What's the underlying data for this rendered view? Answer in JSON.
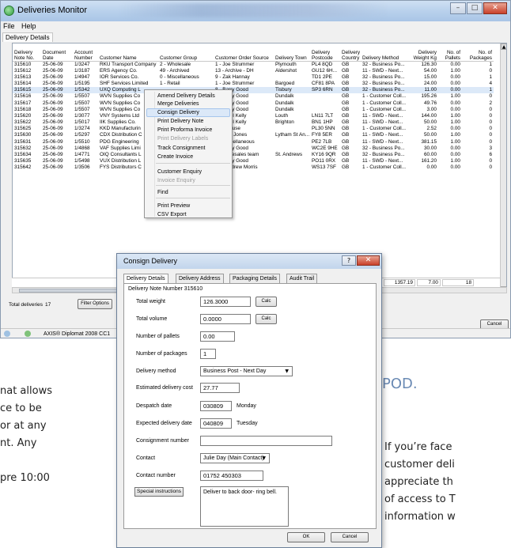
{
  "window": {
    "title": "Deliveries Monitor",
    "menu": [
      "File",
      "Help"
    ],
    "tab": "Delivery Details",
    "controls": [
      "–",
      "□",
      "✕"
    ]
  },
  "grid": {
    "columns": [
      "Delivery Note No.",
      "Document Date",
      "Account Number",
      "Customer Name",
      "Customer Group",
      "Customer Order Source",
      "Delivery Town",
      "Delivery Postcode",
      "Delivery Country",
      "Delivery Method",
      "Delivery Weight Kg",
      "No. of Pallets",
      "No. of Packages"
    ],
    "rows": [
      [
        "315610",
        "25-06-09",
        "1/3247",
        "RKU Transport Company",
        "2 - Wholesale",
        "1 - Joe Strummer",
        "Plymouth",
        "PL4 8QD",
        "GB",
        "32 - Business Po...",
        "126.30",
        "0.00",
        "1"
      ],
      [
        "315612",
        "25-06-09",
        "1/3187",
        "ERS Agency Co.",
        "49 - Archived",
        "13 - Archive - DH",
        "Aldershot",
        "GU12 6H...",
        "GB",
        "11 - SWD - Next...",
        "54.00",
        "1.00",
        "0"
      ],
      [
        "315613",
        "25-06-09",
        "1/4947",
        "IOR Services Co.",
        "0 - Miscellaneous",
        "9 - Zak Hannay",
        "",
        "TD1 2PE",
        "GB",
        "32 - Business Po...",
        "15.00",
        "0.00",
        "1"
      ],
      [
        "315614",
        "25-06-09",
        "1/5195",
        "SHF Services Limited",
        "1 - Retail",
        "1 - Joe Strummer",
        "Bargoed",
        "CF81 8PA",
        "GB",
        "32 - Business Po...",
        "24.00",
        "0.00",
        "4"
      ],
      [
        "315615",
        "25-06-09",
        "1/5342",
        "UXQ Computing L",
        "",
        "8 - Barry Good",
        "Tisbury",
        "SP3 6RN",
        "GB",
        "32 - Business Po...",
        "11.00",
        "0.00",
        "1"
      ],
      [
        "315616",
        "25-06-09",
        "1/5507",
        "WVN Supplies Co",
        "",
        "8 - Barry Good",
        "Dundalk",
        "",
        "GB",
        "1 - Customer Coll...",
        "195.26",
        "1.00",
        "0"
      ],
      [
        "315617",
        "25-06-09",
        "1/5507",
        "WVN Supplies Co",
        "",
        "8 - Barry Good",
        "Dundalk",
        "",
        "GB",
        "1 - Customer Coll...",
        "49.76",
        "0.00",
        "2"
      ],
      [
        "315618",
        "25-06-09",
        "1/5507",
        "WVN Supplies Co",
        "",
        "8 - Barry Good",
        "Dundalk",
        "",
        "GB",
        "1 - Customer Coll...",
        "3.00",
        "0.00",
        "0"
      ],
      [
        "315620",
        "25-06-09",
        "1/3077",
        "VNY Systems Ltd",
        "",
        "3 - Nigel Kelly",
        "Louth",
        "LN11 7LT",
        "GB",
        "11 - SWD - Next...",
        "144.00",
        "1.00",
        "0"
      ],
      [
        "315622",
        "25-06-09",
        "1/5017",
        "IIK Supplies Co.",
        "",
        "3 - Nigel Kelly",
        "Brighton",
        "BN1 1HP",
        "GB",
        "11 - SWD - Next...",
        "50.00",
        "1.00",
        "0"
      ],
      [
        "315625",
        "25-06-09",
        "1/3274",
        "KKD Manufacturin",
        "",
        "6 - Inhouse",
        "",
        "PL30 5NN",
        "GB",
        "1 - Customer Coll...",
        "2.52",
        "0.00",
        "0"
      ],
      [
        "315630",
        "25-06-09",
        "1/5297",
        "CDX Distribution C",
        "",
        "2 - Ellie Jones",
        "Lytham St An...",
        "FY8 5ER",
        "GB",
        "11 - SWD - Next...",
        "50.00",
        "1.00",
        "0"
      ],
      [
        "315631",
        "25-06-09",
        "1/5510",
        "PDG Engineering",
        "",
        "0 - Miscellaneous",
        "",
        "PE2 7LB",
        "GB",
        "11 - SWD - Next...",
        "381.15",
        "1.00",
        "0"
      ],
      [
        "315632",
        "25-06-09",
        "1/4868",
        "VAF Supplies Limi",
        "",
        "8 - Barry Good",
        "",
        "WC2E 9HE",
        "GB",
        "32 - Business Po...",
        "30.00",
        "0.00",
        "3"
      ],
      [
        "315634",
        "25-06-09",
        "1/4771",
        "OIQ Consultants L",
        "",
        "10 - Telesales team",
        "St. Andrews",
        "KY16 9QR",
        "GB",
        "32 - Business Po...",
        "60.00",
        "0.00",
        "6"
      ],
      [
        "315635",
        "25-06-09",
        "1/5498",
        "VUX Distribution L",
        "",
        "8 - Barry Good",
        "",
        "PO11 0RX",
        "GB",
        "11 - SWD - Next...",
        "161.20",
        "1.00",
        "0"
      ],
      [
        "315642",
        "25-06-09",
        "1/3506",
        "FYS Distributors C",
        "",
        "20 - Andrew Morris",
        "",
        "WS13 7SF",
        "GB",
        "1 - Customer Coll...",
        "0.00",
        "0.00",
        "0"
      ]
    ],
    "selected_row": 4,
    "totals": {
      "weight": "1357.19",
      "pallets": "7.00",
      "packages": "18"
    }
  },
  "bottom": {
    "total_label": "Total deliveries",
    "total_value": "17",
    "filter_button": "Filter Options",
    "cancel_button": "Cancel"
  },
  "status": {
    "text": "AXIS® Diplomat 2008 CC1"
  },
  "context_menu": {
    "items": [
      {
        "label": "Amend Delivery Details",
        "enabled": true
      },
      {
        "label": "Merge Deliveries",
        "enabled": true
      },
      {
        "label": "Consign Delivery",
        "enabled": true
      },
      {
        "label": "Print Delivery Note",
        "enabled": true
      },
      {
        "label": "Print Proforma Invoice",
        "enabled": true
      },
      {
        "label": "Print Delivery Labels",
        "enabled": false
      },
      {
        "label": "Track Consignment",
        "enabled": true
      },
      {
        "label": "Create Invoice",
        "enabled": true
      },
      {
        "label": "Customer Enquiry",
        "enabled": true
      },
      {
        "label": "Invoice Enquiry",
        "enabled": false
      },
      {
        "label": "Find",
        "enabled": true
      },
      {
        "label": "Print Preview",
        "enabled": true
      },
      {
        "label": "CSV Export",
        "enabled": true
      }
    ]
  },
  "dialog": {
    "title": "Consign Delivery",
    "help": "?",
    "close": "✕",
    "tabs": [
      "Delivery Details",
      "Delivery Address",
      "Packaging Details",
      "Audit Trail"
    ],
    "note_label": "Delivery Note Number 315610",
    "calc": "Calc",
    "fields": {
      "total_weight_label": "Total weight",
      "total_weight": "126.3000",
      "total_volume_label": "Total volume",
      "total_volume": "0.0000",
      "pallets_label": "Number of pallets",
      "pallets": "0.00",
      "packages_label": "Number of packages",
      "packages": "1",
      "method_label": "Delivery method",
      "method": "Business Post - Next Day",
      "est_cost_label": "Estimated delivery cost",
      "est_cost": "27.77",
      "despatch_label": "Despatch date",
      "despatch_date": "030809",
      "despatch_day": "Monday",
      "expected_label": "Expected delivery date",
      "expected_date": "040809",
      "expected_day": "Tuesday",
      "consignment_label": "Consignment number",
      "consignment": "",
      "contact_label": "Contact",
      "contact": "Julie Day (Main Contact)",
      "contact_number_label": "Contact number",
      "contact_number": "01752 450303",
      "special_label": "Special instructions",
      "special": "Deliver to back door- ring bell."
    },
    "ok": "OK",
    "cancel": "Cancel"
  },
  "background": {
    "left_lines": [
      "nat allows",
      "ce to be",
      "or at any",
      "nt. Any",
      "pre 10:00"
    ],
    "pod_heading": "POD.",
    "right_lines": [
      "If you’re face",
      "customer deli",
      "appreciate th",
      "of access to T",
      "information w"
    ]
  }
}
